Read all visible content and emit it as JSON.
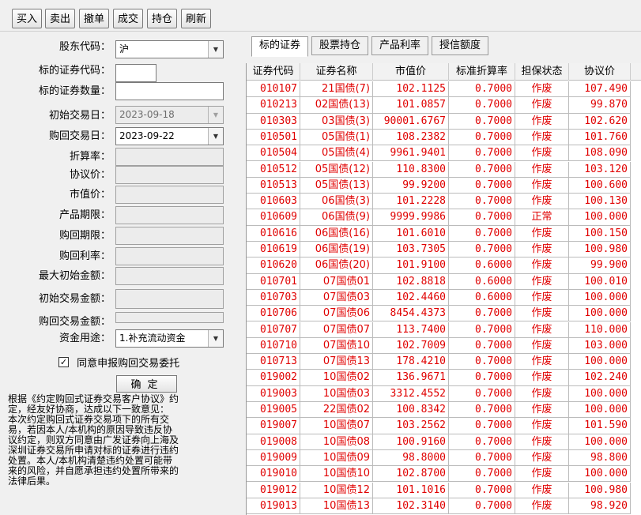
{
  "toolbar": {
    "buttons": [
      "买入",
      "卖出",
      "撤单",
      "成交",
      "持仓",
      "刷新"
    ]
  },
  "form": {
    "shareholder_code": {
      "label": "股东代码：",
      "value": "沪"
    },
    "security_code": {
      "label": "标的证券代码：",
      "value": ""
    },
    "security_qty": {
      "label": "标的证券数量：",
      "value": ""
    },
    "initial_date": {
      "label": "初始交易日：",
      "value": "2023-09-18"
    },
    "repurchase_date": {
      "label": "购回交易日：",
      "value": "2023-09-22"
    },
    "discount_rate": {
      "label": "折算率：",
      "value": ""
    },
    "agreed_price": {
      "label": "协议价：",
      "value": ""
    },
    "market_value": {
      "label": "市值价：",
      "value": ""
    },
    "product_term": {
      "label": "产品期限：",
      "value": ""
    },
    "repurchase_term": {
      "label": "购回期限：",
      "value": ""
    },
    "repurchase_rate": {
      "label": "购回利率：",
      "value": ""
    },
    "max_initial_amount": {
      "label": "最大初始金额：",
      "value": ""
    },
    "initial_amount": {
      "label": "初始交易金额：",
      "value": ""
    },
    "repurchase_amount": {
      "label": "购回交易金额：",
      "value": ""
    },
    "fund_use": {
      "label": "资金用途：",
      "value": "1.补充流动资金"
    },
    "agree_checkbox": {
      "label": "同意申报购回交易委托",
      "checked": true
    },
    "confirm_label": "确定",
    "notice": "根据《约定购回式证券交易客户协议》约\n定，经友好协商，达成以下一致意见：\n本次约定购回式证券交易项下的所有交\n易，若因本人/本机构的原因导致违反协\n议约定，则双方同意由广发证券向上海及\n深圳证券交易所申请对标的证券进行违约\n处置。本人/本机构清楚违约处置可能带\n来的风险，并自愿承担违约处置所带来的\n法律后果。"
  },
  "tabs": [
    "标的证券",
    "股票持仓",
    "产品利率",
    "授信额度"
  ],
  "table": {
    "columns": [
      "证券代码",
      "证券名称",
      "市值价",
      "标准折算率",
      "担保状态",
      "协议价"
    ],
    "rows": [
      [
        "010107",
        "21国债(7)",
        "102.1125",
        "0.7000",
        "作废",
        "107.490"
      ],
      [
        "010213",
        "02国债(13)",
        "101.0857",
        "0.7000",
        "作废",
        "99.870"
      ],
      [
        "010303",
        "03国债(3)",
        "90001.6767",
        "0.7000",
        "作废",
        "102.620"
      ],
      [
        "010501",
        "05国债(1)",
        "108.2382",
        "0.7000",
        "作废",
        "101.760"
      ],
      [
        "010504",
        "05国债(4)",
        "9961.9401",
        "0.7000",
        "作废",
        "108.090"
      ],
      [
        "010512",
        "05国债(12)",
        "110.8300",
        "0.7000",
        "作废",
        "103.120"
      ],
      [
        "010513",
        "05国债(13)",
        "99.9200",
        "0.7000",
        "作废",
        "100.600"
      ],
      [
        "010603",
        "06国债(3)",
        "101.2228",
        "0.7000",
        "作废",
        "100.130"
      ],
      [
        "010609",
        "06国债(9)",
        "9999.9986",
        "0.7000",
        "正常",
        "100.000"
      ],
      [
        "010616",
        "06国债(16)",
        "101.6010",
        "0.7000",
        "作废",
        "100.150"
      ],
      [
        "010619",
        "06国债(19)",
        "103.7305",
        "0.7000",
        "作废",
        "100.980"
      ],
      [
        "010620",
        "06国债(20)",
        "101.9100",
        "0.6000",
        "作废",
        "99.900"
      ],
      [
        "010701",
        "07国债01",
        "102.8818",
        "0.6000",
        "作废",
        "100.010"
      ],
      [
        "010703",
        "07国债03",
        "102.4460",
        "0.6000",
        "作废",
        "100.000"
      ],
      [
        "010706",
        "07国债06",
        "8454.4373",
        "0.7000",
        "作废",
        "100.000"
      ],
      [
        "010707",
        "07国债07",
        "113.7400",
        "0.7000",
        "作废",
        "110.000"
      ],
      [
        "010710",
        "07国债10",
        "102.7009",
        "0.7000",
        "作废",
        "103.000"
      ],
      [
        "010713",
        "07国债13",
        "178.4210",
        "0.7000",
        "作废",
        "100.000"
      ],
      [
        "019002",
        "10国债02",
        "136.9671",
        "0.7000",
        "作废",
        "102.240"
      ],
      [
        "019003",
        "10国债03",
        "3312.4552",
        "0.7000",
        "作废",
        "100.000"
      ],
      [
        "019005",
        "22国债02",
        "100.8342",
        "0.7000",
        "作废",
        "100.000"
      ],
      [
        "019007",
        "10国债07",
        "103.2562",
        "0.7000",
        "作废",
        "101.590"
      ],
      [
        "019008",
        "10国债08",
        "100.9160",
        "0.7000",
        "作废",
        "100.000"
      ],
      [
        "019009",
        "10国债09",
        "98.8000",
        "0.7000",
        "作废",
        "98.800"
      ],
      [
        "019010",
        "10国债10",
        "102.8700",
        "0.7000",
        "作废",
        "100.000"
      ],
      [
        "019012",
        "10国债12",
        "101.1016",
        "0.7000",
        "作废",
        "100.980"
      ],
      [
        "019013",
        "10国债13",
        "102.3140",
        "0.7000",
        "作废",
        "98.920"
      ]
    ]
  }
}
